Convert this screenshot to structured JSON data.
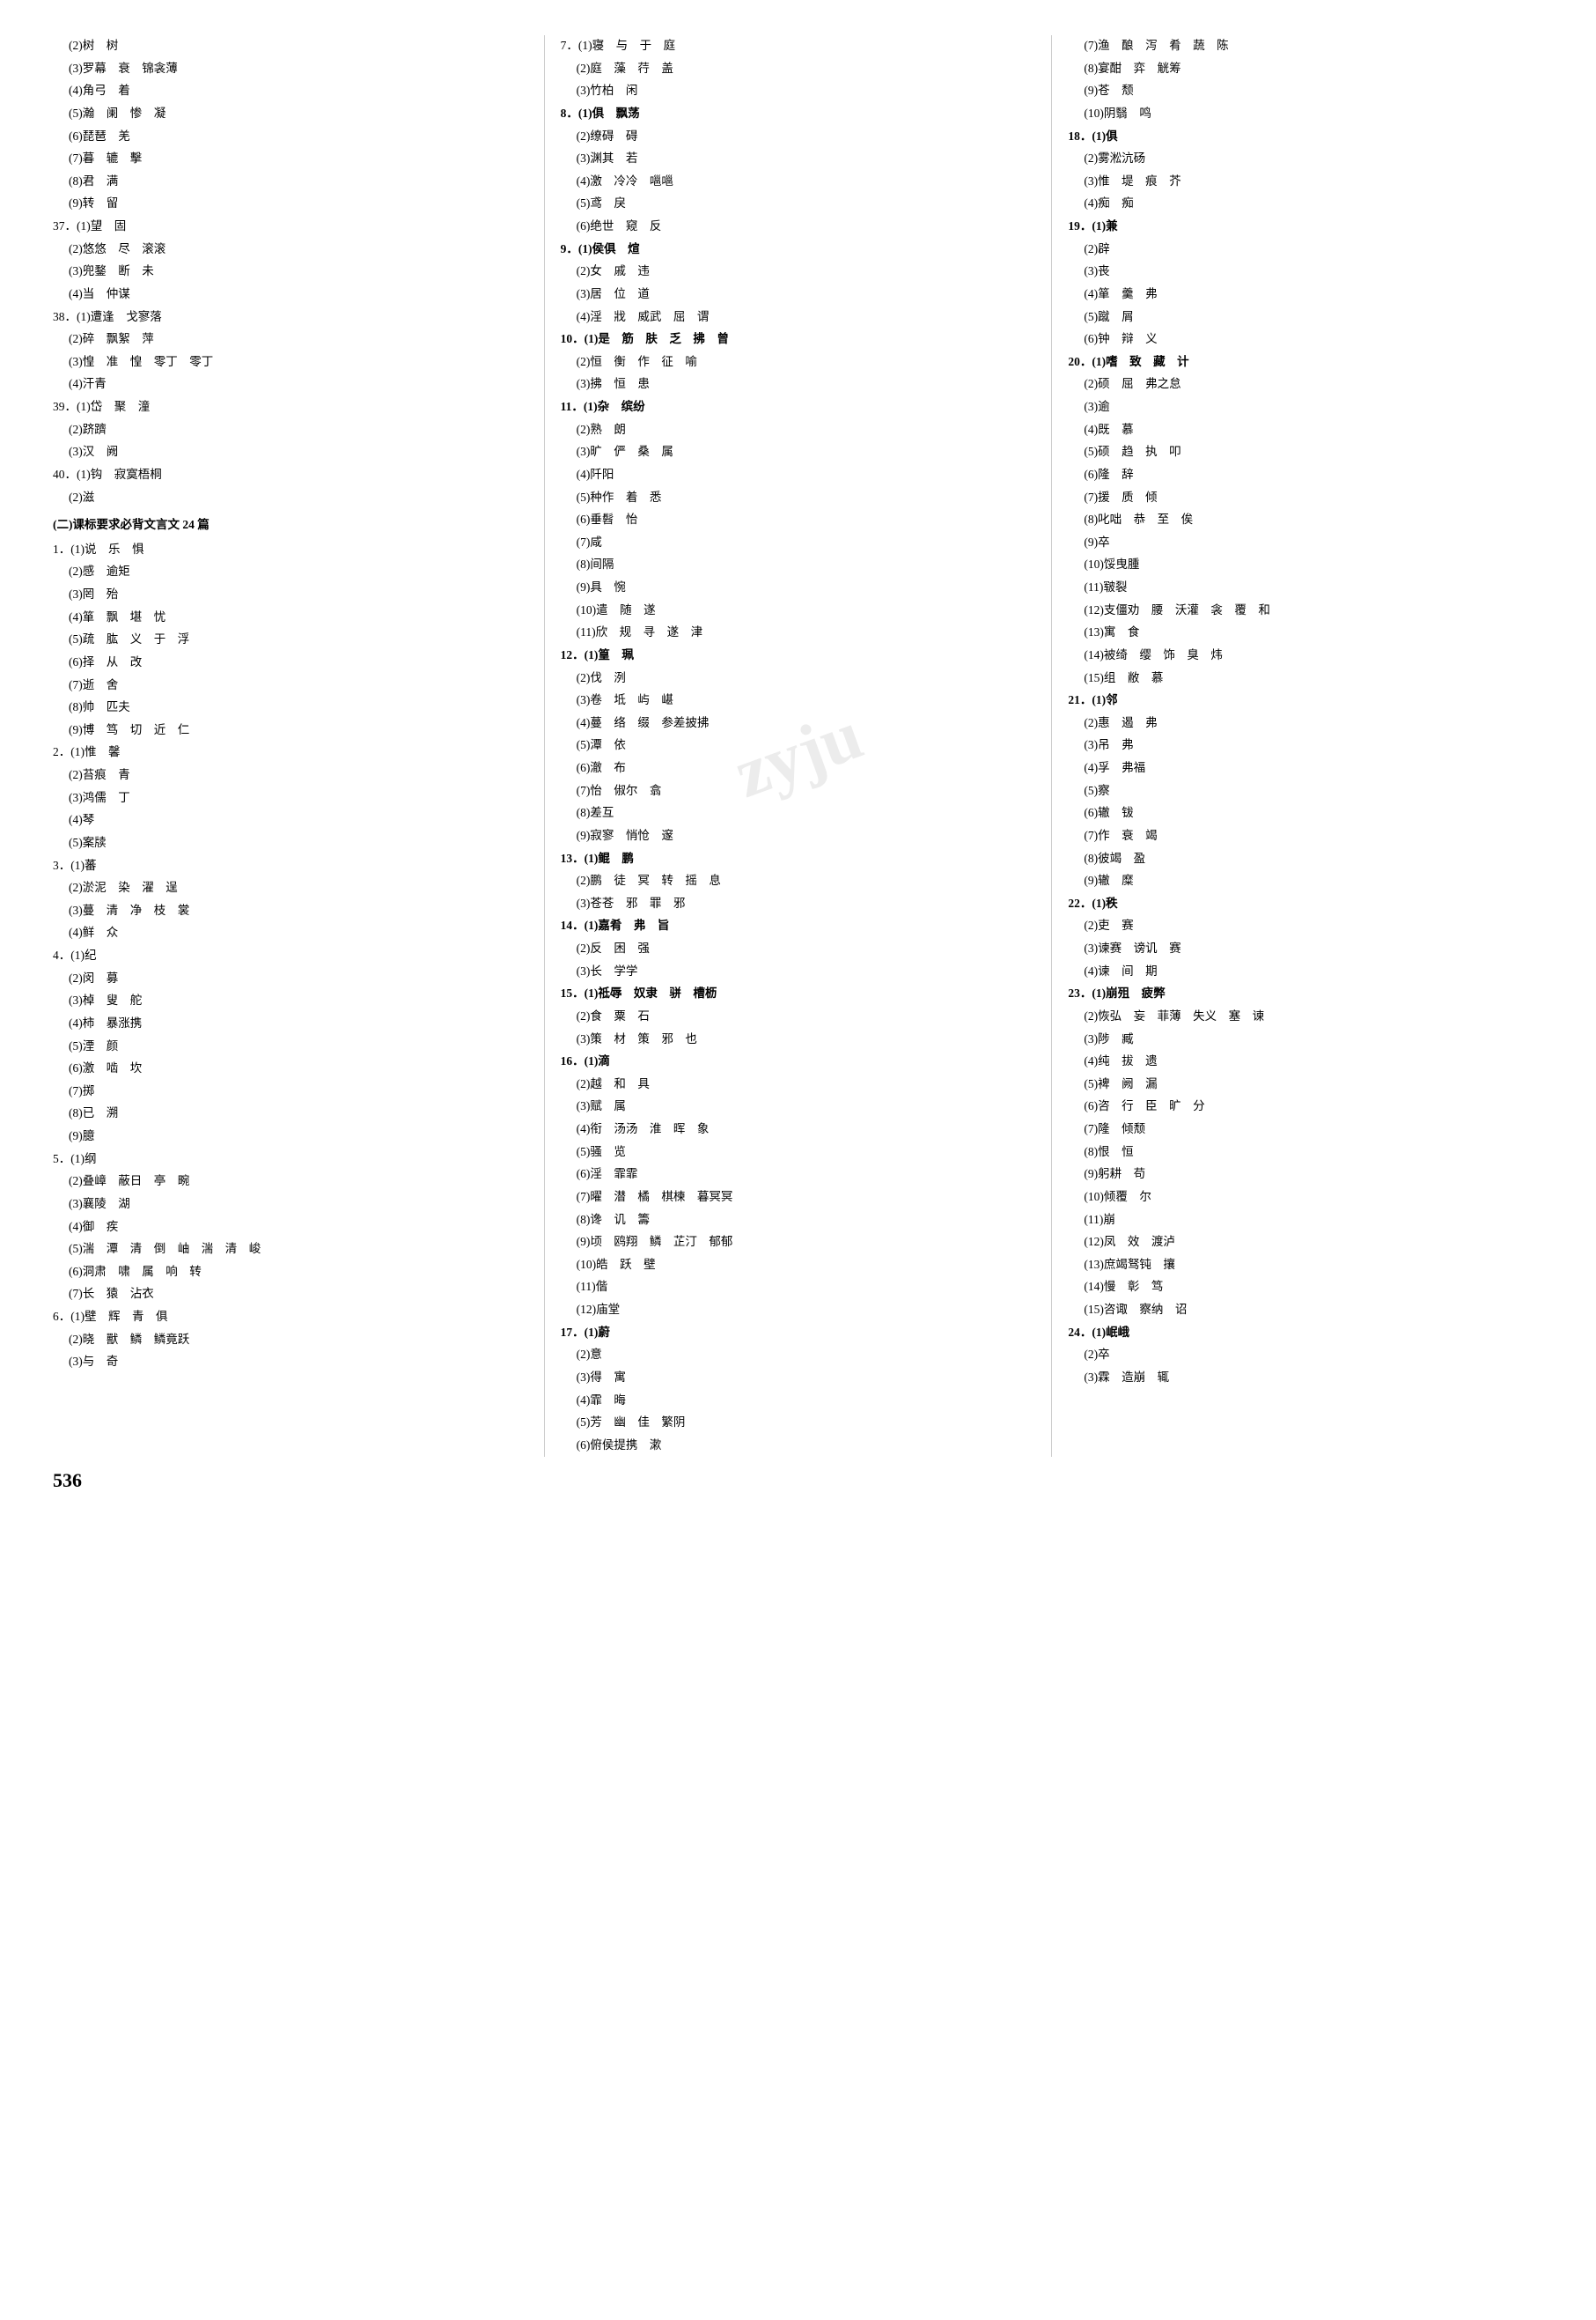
{
  "page": {
    "number": "536",
    "watermark": "zyju"
  },
  "columns": [
    {
      "id": "col1",
      "content": [
        {
          "type": "sub",
          "text": "(2)树　树"
        },
        {
          "type": "sub",
          "text": "(3)罗幕　衰　锦衾薄"
        },
        {
          "type": "sub",
          "text": "(4)角弓　着"
        },
        {
          "type": "sub",
          "text": "(5)瀚　阑　惨　凝"
        },
        {
          "type": "sub",
          "text": "(6)琵琶　羌"
        },
        {
          "type": "sub",
          "text": "(7)暮　辘　擊"
        },
        {
          "type": "sub",
          "text": "(8)君　满"
        },
        {
          "type": "sub",
          "text": "(9)转　留"
        },
        {
          "type": "main",
          "text": "37．(1)望　固"
        },
        {
          "type": "sub",
          "text": "(2)悠悠　尽　滚滚"
        },
        {
          "type": "sub",
          "text": "(3)兜鍪　断　未"
        },
        {
          "type": "sub",
          "text": "(4)当　仲谋"
        },
        {
          "type": "main",
          "text": "38．(1)遭逢　戈寥落"
        },
        {
          "type": "sub",
          "text": "(2)碎　飘絮　萍"
        },
        {
          "type": "sub",
          "text": "(3)惶　准　惶　零丁　零丁"
        },
        {
          "type": "sub",
          "text": "(4)汗青"
        },
        {
          "type": "main",
          "text": "39．(1)岱　聚　潼"
        },
        {
          "type": "sub",
          "text": "(2)跻躋"
        },
        {
          "type": "sub",
          "text": "(3)汉　阙"
        },
        {
          "type": "main",
          "text": "40．(1)钩　寂寞梧桐"
        },
        {
          "type": "sub",
          "text": "(2)滋"
        },
        {
          "type": "section",
          "text": "(二)课标要求必背文言文 24 篇"
        },
        {
          "type": "main",
          "text": "1．(1)说　乐　惧"
        },
        {
          "type": "sub",
          "text": "(2)感　逾矩"
        },
        {
          "type": "sub",
          "text": "(3)罔　殆"
        },
        {
          "type": "sub",
          "text": "(4)箪　飘　堪　忧"
        },
        {
          "type": "sub",
          "text": "(5)疏　肱　义　于　浮"
        },
        {
          "type": "sub",
          "text": "(6)择　从　改"
        },
        {
          "type": "sub",
          "text": "(7)逝　舍"
        },
        {
          "type": "sub",
          "text": "(8)帅　匹夫"
        },
        {
          "type": "sub",
          "text": "(9)博　笃　切　近　仁"
        },
        {
          "type": "main",
          "text": "2．(1)惟　馨"
        },
        {
          "type": "sub",
          "text": "(2)苔痕　青"
        },
        {
          "type": "sub",
          "text": "(3)鸿儒　丁"
        },
        {
          "type": "sub",
          "text": "(4)琴"
        },
        {
          "type": "sub",
          "text": "(5)案牍"
        },
        {
          "type": "main",
          "text": "3．(1)蕃"
        },
        {
          "type": "sub",
          "text": "(2)淤泥　染　濯　逞"
        },
        {
          "type": "sub",
          "text": "(3)蔓　清　净　枝　裳"
        },
        {
          "type": "sub",
          "text": "(4)鲜　众"
        },
        {
          "type": "main",
          "text": "4．(1)纪"
        },
        {
          "type": "sub",
          "text": "(2)闵　募"
        },
        {
          "type": "sub",
          "text": "(3)棹　叟　舵"
        },
        {
          "type": "sub",
          "text": "(4)柿　暴涨携"
        },
        {
          "type": "sub",
          "text": "(5)湮　颜"
        },
        {
          "type": "sub",
          "text": "(6)激　啮　坎"
        },
        {
          "type": "sub",
          "text": "(7)掷"
        },
        {
          "type": "sub",
          "text": "(8)已　溯"
        },
        {
          "type": "sub",
          "text": "(9)臆"
        },
        {
          "type": "main",
          "text": "5．(1)纲"
        },
        {
          "type": "sub",
          "text": "(2)叠嶂　蔽日　亭　畹"
        },
        {
          "type": "sub",
          "text": "(3)襄陵　湖"
        },
        {
          "type": "sub",
          "text": "(4)御　疾"
        },
        {
          "type": "sub",
          "text": "(5)湍　潭　清　倒　岫　湍　清　峻"
        },
        {
          "type": "sub",
          "text": "(6)洞肃　啸　属　响　转"
        },
        {
          "type": "sub",
          "text": "(7)长　猿　沾衣"
        },
        {
          "type": "main",
          "text": "6．(1)壁　辉　青　俱"
        },
        {
          "type": "sub",
          "text": "(2)晓　獸　鳞　鳞竟跃"
        },
        {
          "type": "sub",
          "text": "(3)与　奇"
        }
      ]
    },
    {
      "id": "col2",
      "content": [
        {
          "type": "main",
          "text": "7．(1)寝　与　于　庭"
        },
        {
          "type": "sub",
          "text": "(2)庭　藻　荇　盖"
        },
        {
          "type": "sub",
          "text": "(3)竹柏　闲"
        },
        {
          "type": "main_bold",
          "text": "8．(1)俱　飘荡"
        },
        {
          "type": "sub",
          "text": "(2)缭碍　碍"
        },
        {
          "type": "sub",
          "text": "(3)渊其　若"
        },
        {
          "type": "sub",
          "text": "(4)激　冷冷　嗈嗈"
        },
        {
          "type": "sub",
          "text": "(5)鸢　戾"
        },
        {
          "type": "sub",
          "text": "(6)绝世　窥　反"
        },
        {
          "type": "main_bold",
          "text": "9．(1)侯俱　煊"
        },
        {
          "type": "sub",
          "text": "(2)女　戚　违"
        },
        {
          "type": "sub",
          "text": "(3)居　位　道"
        },
        {
          "type": "sub",
          "text": "(4)淫　戕　威武　屈　谓"
        },
        {
          "type": "main_bold",
          "text": "10．(1)是　筋　肤　乏　拂　曾"
        },
        {
          "type": "sub",
          "text": "(2)恒　衡　作　征　喻"
        },
        {
          "type": "sub",
          "text": "(3)拂　恒　患"
        },
        {
          "type": "main_bold",
          "text": "11．(1)杂　缤纷"
        },
        {
          "type": "sub",
          "text": "(2)熟　朗"
        },
        {
          "type": "sub",
          "text": "(3)旷　俨　桑　属"
        },
        {
          "type": "sub",
          "text": "(4)阡阳"
        },
        {
          "type": "sub",
          "text": "(5)种作　着　悉"
        },
        {
          "type": "sub",
          "text": "(6)垂髫　怡"
        },
        {
          "type": "sub",
          "text": "(7)咸"
        },
        {
          "type": "sub",
          "text": "(8)间隔"
        },
        {
          "type": "sub",
          "text": "(9)具　惋"
        },
        {
          "type": "sub",
          "text": "(10)遣　随　遂"
        },
        {
          "type": "sub",
          "text": "(11)欣　规　寻　遂　津"
        },
        {
          "type": "main_bold",
          "text": "12．(1)篁　珮"
        },
        {
          "type": "sub",
          "text": "(2)伐　洌"
        },
        {
          "type": "sub",
          "text": "(3)卷　坻　屿　嵁"
        },
        {
          "type": "sub",
          "text": "(4)蔓　络　缀　参差披拂"
        },
        {
          "type": "sub",
          "text": "(5)潭　依"
        },
        {
          "type": "sub",
          "text": "(6)澈　布"
        },
        {
          "type": "sub",
          "text": "(7)怡　俶尔　翕"
        },
        {
          "type": "sub",
          "text": "(8)差互"
        },
        {
          "type": "sub",
          "text": "(9)寂寥　悄怆　邃"
        },
        {
          "type": "main_bold",
          "text": "13．(1)鲲　鹏"
        },
        {
          "type": "sub",
          "text": "(2)鹏　徒　冥　转　摇　息"
        },
        {
          "type": "sub",
          "text": "(3)苍苍　邪　罪　邪"
        },
        {
          "type": "main_bold",
          "text": "14．(1)嘉肴　弗　旨"
        },
        {
          "type": "sub",
          "text": "(2)反　困　强"
        },
        {
          "type": "sub",
          "text": "(3)长　学学"
        },
        {
          "type": "main_bold",
          "text": "15．(1)祗辱　奴隶　骈　槽枥"
        },
        {
          "type": "sub",
          "text": "(2)食　粟　石"
        },
        {
          "type": "sub",
          "text": "(3)策　材　策　邪　也"
        },
        {
          "type": "main_bold",
          "text": "16．(1)滴"
        },
        {
          "type": "sub",
          "text": "(2)越　和　具"
        },
        {
          "type": "sub",
          "text": "(3)赋　属"
        },
        {
          "type": "sub",
          "text": "(4)衔　汤汤　淮　晖　象"
        },
        {
          "type": "sub",
          "text": "(5)骚　览"
        },
        {
          "type": "sub",
          "text": "(6)淫　霏霏"
        },
        {
          "type": "sub",
          "text": "(7)曜　潜　橘　棋楝　暮冥冥"
        },
        {
          "type": "sub",
          "text": "(8)谗　讥　籌"
        },
        {
          "type": "sub",
          "text": "(9)顷　鸥翔　鳞　芷汀　郁郁"
        },
        {
          "type": "sub",
          "text": "(10)皓　跃　壁"
        },
        {
          "type": "sub",
          "text": "(11)偕"
        },
        {
          "type": "sub",
          "text": "(12)庙堂"
        },
        {
          "type": "main_bold",
          "text": "17．(1)蔚"
        },
        {
          "type": "sub",
          "text": "(2)意"
        },
        {
          "type": "sub",
          "text": "(3)得　寓"
        },
        {
          "type": "sub",
          "text": "(4)霏　晦"
        },
        {
          "type": "sub",
          "text": "(5)芳　幽　佳　繁阴"
        },
        {
          "type": "sub",
          "text": "(6)俯侯提携　漱"
        }
      ]
    },
    {
      "id": "col3",
      "content": [
        {
          "type": "sub",
          "text": "(7)渔　酿　泻　肴　蔬　陈"
        },
        {
          "type": "sub",
          "text": "(8)宴酣　弈　觥筹"
        },
        {
          "type": "sub",
          "text": "(9)苍　颓"
        },
        {
          "type": "sub",
          "text": "(10)阴翳　鸣"
        },
        {
          "type": "main_bold",
          "text": "18．(1)俱"
        },
        {
          "type": "sub",
          "text": "(2)雾淞沆砀"
        },
        {
          "type": "sub",
          "text": "(3)惟　堤　痕　芥"
        },
        {
          "type": "sub",
          "text": "(4)痴　痴"
        },
        {
          "type": "main_bold",
          "text": "19．(1)兼"
        },
        {
          "type": "sub",
          "text": "(2)辟"
        },
        {
          "type": "sub",
          "text": "(3)丧"
        },
        {
          "type": "sub",
          "text": "(4)箪　羹　弗"
        },
        {
          "type": "sub",
          "text": "(5)蹴　屑"
        },
        {
          "type": "sub",
          "text": "(6)钟　辩　义"
        },
        {
          "type": "main_bold",
          "text": "20．(1)嗜　致　藏　计"
        },
        {
          "type": "sub",
          "text": "(2)硕　屈　弗之怠"
        },
        {
          "type": "sub",
          "text": "(3)逾"
        },
        {
          "type": "sub",
          "text": "(4)既　慕"
        },
        {
          "type": "sub",
          "text": "(5)硕　趋　执　叩"
        },
        {
          "type": "sub",
          "text": "(6)隆　辞"
        },
        {
          "type": "sub",
          "text": "(7)援　质　倾"
        },
        {
          "type": "sub",
          "text": "(8)叱咄　恭　至　俟"
        },
        {
          "type": "sub",
          "text": "(9)卒"
        },
        {
          "type": "sub",
          "text": "(10)馁曳腫"
        },
        {
          "type": "sub",
          "text": "(11)皲裂"
        },
        {
          "type": "sub",
          "text": "(12)支僵劝　腰　沃灌　衾　覆　和"
        },
        {
          "type": "sub",
          "text": "(13)寓　食"
        },
        {
          "type": "sub",
          "text": "(14)被绮　缨　饰　臭　炜"
        },
        {
          "type": "sub",
          "text": "(15)组　敝　慕"
        },
        {
          "type": "main_bold",
          "text": "21．(1)邻"
        },
        {
          "type": "sub",
          "text": "(2)惠　遏　弗"
        },
        {
          "type": "sub",
          "text": "(3)吊　弗"
        },
        {
          "type": "sub",
          "text": "(4)孚　弗福"
        },
        {
          "type": "sub",
          "text": "(5)察"
        },
        {
          "type": "sub",
          "text": "(6)辙　钹"
        },
        {
          "type": "sub",
          "text": "(7)作　衰　竭"
        },
        {
          "type": "sub",
          "text": "(8)彼竭　盈"
        },
        {
          "type": "sub",
          "text": "(9)辙　糜"
        },
        {
          "type": "main_bold",
          "text": "22．(1)秩"
        },
        {
          "type": "sub",
          "text": "(2)吏　赛"
        },
        {
          "type": "sub",
          "text": "(3)谏赛　谤讥　赛"
        },
        {
          "type": "sub",
          "text": "(4)谏　间　期"
        },
        {
          "type": "main_bold",
          "text": "23．(1)崩殂　疲弊"
        },
        {
          "type": "sub",
          "text": "(2)恢弘　妄　菲薄　失义　塞　谏"
        },
        {
          "type": "sub",
          "text": "(3)陟　臧"
        },
        {
          "type": "sub",
          "text": "(4)纯　拔　遗"
        },
        {
          "type": "sub",
          "text": "(5)裨　阙　漏"
        },
        {
          "type": "sub",
          "text": "(6)咨　行　臣　旷　分"
        },
        {
          "type": "sub",
          "text": "(7)隆　倾颓"
        },
        {
          "type": "sub",
          "text": "(8)恨　恒"
        },
        {
          "type": "sub",
          "text": "(9)躬耕　苟"
        },
        {
          "type": "sub",
          "text": "(10)倾覆　尔"
        },
        {
          "type": "sub",
          "text": "(11)崩"
        },
        {
          "type": "sub",
          "text": "(12)凤　效　渡泸"
        },
        {
          "type": "sub",
          "text": "(13)庶竭驽钝　攘"
        },
        {
          "type": "sub",
          "text": "(14)慢　彰　笃"
        },
        {
          "type": "sub",
          "text": "(15)咨诹　察纳　诏"
        },
        {
          "type": "main_bold",
          "text": "24．(1)岷峨"
        },
        {
          "type": "sub",
          "text": "(2)卒"
        },
        {
          "type": "sub",
          "text": "(3)霖　造崩　辄"
        }
      ]
    }
  ]
}
